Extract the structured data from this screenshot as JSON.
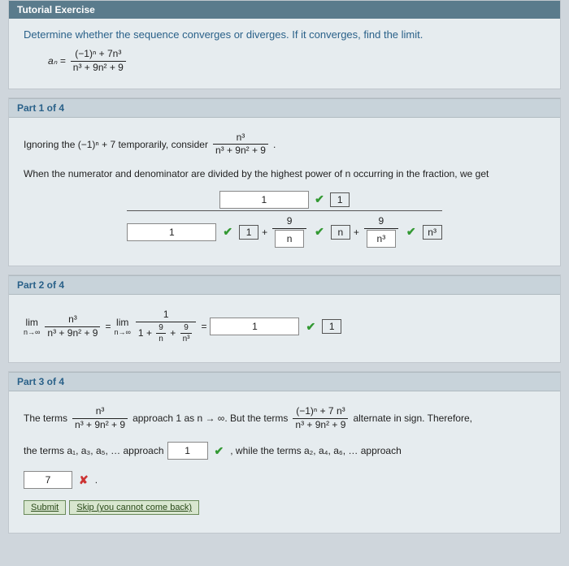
{
  "tutorial": {
    "header": "Tutorial Exercise",
    "prompt": "Determine whether the sequence converges or diverges. If it converges, find the limit.",
    "a_n_label": "aₙ =",
    "seq_num": "(−1)ⁿ + 7n³",
    "seq_den": "n³ + 9n² + 9"
  },
  "part1": {
    "label": "Part 1 of 4",
    "line1_prefix": "Ignoring the  (−1)ⁿ + 7  temporarily, consider",
    "cons_num": "n³",
    "cons_den": "n³ + 9n² + 9",
    "line2": "When the numerator and denominator are divided by the highest power of n occurring in the fraction, we get",
    "top_input_val": "1",
    "top_box": "1",
    "denom_input1": "1",
    "denom_box1": "1",
    "nine_a": "9",
    "denom_input2": "n",
    "denom_box2": "n",
    "nine_b": "9",
    "denom_input3": "n³",
    "denom_box3": "n³"
  },
  "part2": {
    "label": "Part 2 of 4",
    "lim_text": "lim",
    "lim_sub": "n→∞",
    "frac_num": "n³",
    "frac_den": "n³ + 9n² + 9",
    "eq": "=",
    "one": "1",
    "plus": "+",
    "nine": "9",
    "over_n": "n",
    "over_n3": "n³",
    "answer_input": "1",
    "answer_box": "1"
  },
  "part3": {
    "label": "Part 3 of 4",
    "text1": "The terms",
    "frac1_num": "n³",
    "frac1_den": "n³ + 9n² + 9",
    "text2": "approach 1 as n → ∞. But the terms",
    "frac2_num": "(−1)ⁿ + 7 n³",
    "frac2_den": "n³ + 9n² + 9",
    "text3": "alternate in sign. Therefore,",
    "text4": "the terms  a₁, a₃, a₅, …  approach",
    "input_odd": "1",
    "text5": ", while the terms  a₂, a₄, a₆, …  approach",
    "input_even": "7",
    "submit": "Submit",
    "skip": "Skip (you cannot come back)"
  }
}
